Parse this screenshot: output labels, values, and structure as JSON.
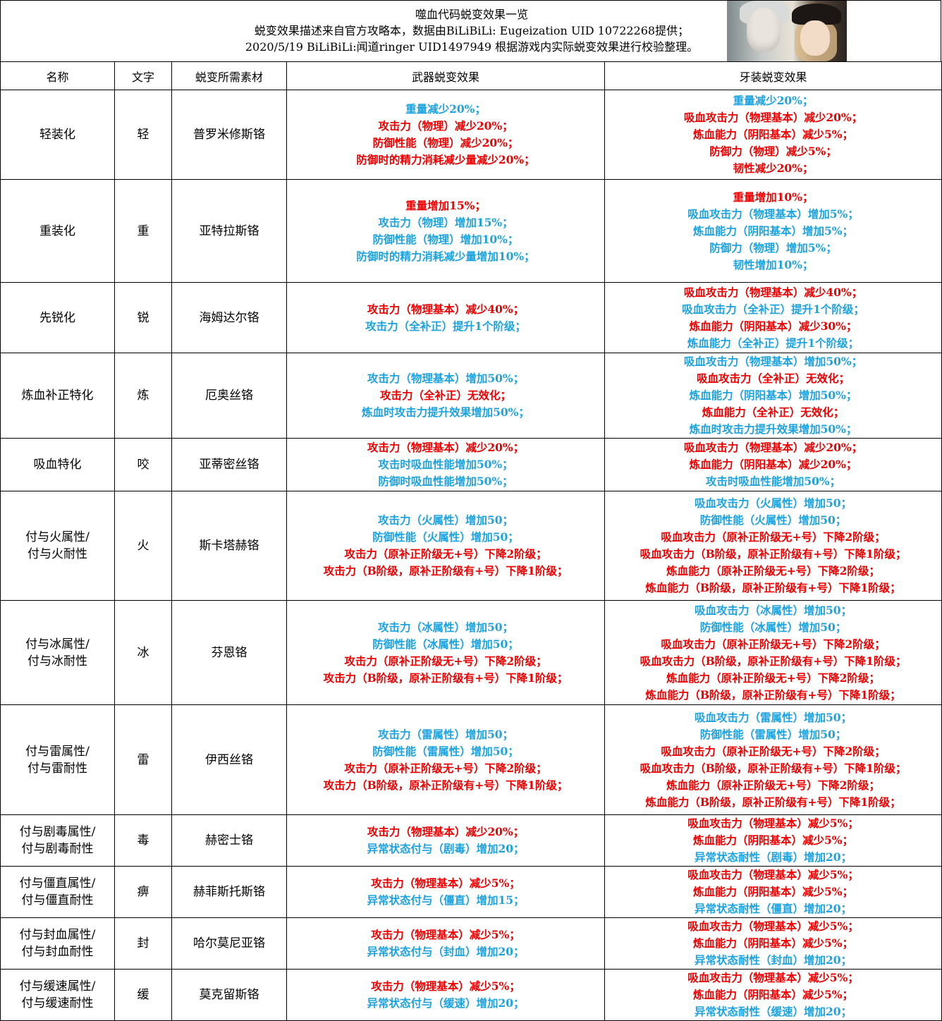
{
  "header": {
    "title": "噬血代码蜕变效果一览",
    "line2": "蜕变效果描述来自官方攻略本，数据由BiLiBiLi: Eugeization UID 10722268提供；",
    "line3": "2020/5/19 BiLiBiLi:闻道ringer UID1497949 根据游戏内实际蜕变效果进行校验整理。"
  },
  "colors": {
    "positive": "#1ba3e0",
    "negative": "#ee0000"
  },
  "columns": [
    "名称",
    "文字",
    "蜕变所需素材",
    "武器蜕变效果",
    "牙装蜕变效果"
  ],
  "rows": [
    {
      "name": [
        "轻装化"
      ],
      "char": "轻",
      "material": "普罗米修斯铬",
      "weapon": [
        {
          "text": "重量减少20%；",
          "c": "blue"
        },
        {
          "text": "攻击力（物理）减少20%；",
          "c": "red"
        },
        {
          "text": "防御性能（物理）减少20%；",
          "c": "red"
        },
        {
          "text": "防御时的精力消耗减少量减少20%；",
          "c": "red"
        }
      ],
      "veil": [
        {
          "text": "重量减少20%；",
          "c": "blue"
        },
        {
          "text": "吸血攻击力（物理基本）减少20%；",
          "c": "red"
        },
        {
          "text": "炼血能力（阴阳基本）减少5%；",
          "c": "red"
        },
        {
          "text": "防御力（物理）减少5%；",
          "c": "red"
        },
        {
          "text": "韧性减少20%；",
          "c": "red"
        }
      ]
    },
    {
      "name": [
        "重装化"
      ],
      "char": "重",
      "material": "亚特拉斯铬",
      "weapon": [
        {
          "text": "重量增加15%；",
          "c": "red"
        },
        {
          "text": "攻击力（物理）增加15%；",
          "c": "blue"
        },
        {
          "text": "防御性能（物理）增加10%；",
          "c": "blue"
        },
        {
          "text": "防御时的精力消耗减少量增加10%；",
          "c": "blue"
        }
      ],
      "veil": [
        {
          "text": "重量增加10%；",
          "c": "red"
        },
        {
          "text": "吸血攻击力（物理基本）增加5%；",
          "c": "blue"
        },
        {
          "text": "炼血能力（阴阳基本）增加5%；",
          "c": "blue"
        },
        {
          "text": "防御力（物理）增加5%；",
          "c": "blue"
        },
        {
          "text": "韧性增加10%；",
          "c": "blue"
        }
      ]
    },
    {
      "name": [
        "先锐化"
      ],
      "char": "锐",
      "material": "海姆达尔铬",
      "weapon": [
        {
          "text": "攻击力（物理基本）减少40%；",
          "c": "red"
        },
        {
          "text": "攻击力（全补正）提升1个阶级；",
          "c": "blue"
        }
      ],
      "veil": [
        {
          "text": "吸血攻击力（物理基本）减少40%；",
          "c": "red"
        },
        {
          "text": "吸血攻击力（全补正）提升1个阶级；",
          "c": "blue"
        },
        {
          "text": "炼血能力（阴阳基本）减少30%；",
          "c": "red"
        },
        {
          "text": "炼血能力（全补正）提升1个阶级；",
          "c": "blue"
        }
      ]
    },
    {
      "name": [
        "炼血补正特化"
      ],
      "char": "炼",
      "material": "厄奥丝铬",
      "weapon": [
        {
          "text": "攻击力（物理基本）增加50%；",
          "c": "blue"
        },
        {
          "text": "攻击力（全补正）无效化；",
          "c": "red"
        },
        {
          "text": "炼血时攻击力提升效果增加50%；",
          "c": "blue"
        }
      ],
      "veil": [
        {
          "text": "吸血攻击力（物理基本）增加50%；",
          "c": "blue"
        },
        {
          "text": "吸血攻击力（全补正）无效化；",
          "c": "red"
        },
        {
          "text": "炼血能力（阴阳基本）增加50%；",
          "c": "blue"
        },
        {
          "text": "炼血能力（全补正）无效化；",
          "c": "red"
        },
        {
          "text": "炼血时攻击力提升效果增加50%；",
          "c": "blue"
        }
      ]
    },
    {
      "name": [
        "吸血特化"
      ],
      "char": "咬",
      "material": "亚蒂密丝铬",
      "weapon": [
        {
          "text": "攻击力（物理基本）减少20%；",
          "c": "red"
        },
        {
          "text": "攻击时吸血性能增加50%；",
          "c": "blue"
        },
        {
          "text": "防御时吸血性能增加50%；",
          "c": "blue"
        }
      ],
      "veil": [
        {
          "text": "吸血攻击力（物理基本）减少20%；",
          "c": "red"
        },
        {
          "text": "炼血能力（阴阳基本）减少20%；",
          "c": "red"
        },
        {
          "text": "攻击时吸血性能增加50%；",
          "c": "blue"
        }
      ]
    },
    {
      "name": [
        "付与火属性/",
        "付与火耐性"
      ],
      "char": "火",
      "material": "斯卡塔赫铬",
      "weapon": [
        {
          "text": "攻击力（火属性）增加50；",
          "c": "blue"
        },
        {
          "text": "防御性能（火属性）增加50；",
          "c": "blue"
        },
        {
          "text": "攻击力（原补正阶级无+号）下降2阶级；",
          "c": "red"
        },
        {
          "text": "攻击力（B阶级，原补正阶级有+号）下降1阶级；",
          "c": "red"
        }
      ],
      "veil": [
        {
          "text": "吸血攻击力（火属性）增加50；",
          "c": "blue"
        },
        {
          "text": "防御性能（火属性）增加50；",
          "c": "blue"
        },
        {
          "text": "吸血攻击力（原补正阶级无+号）下降2阶级；",
          "c": "red"
        },
        {
          "text": "吸血攻击力（B阶级，原补正阶级有+号）下降1阶级；",
          "c": "red"
        },
        {
          "text": "炼血能力（原补正阶级无+号）下降2阶级；",
          "c": "red"
        },
        {
          "text": "炼血能力（B阶级，原补正阶级有+号）下降1阶级；",
          "c": "red"
        }
      ]
    },
    {
      "name": [
        "付与冰属性/",
        "付与冰耐性"
      ],
      "char": "冰",
      "material": "芬恩铬",
      "weapon": [
        {
          "text": "攻击力（冰属性）增加50；",
          "c": "blue"
        },
        {
          "text": "防御性能（冰属性）增加50；",
          "c": "blue"
        },
        {
          "text": "攻击力（原补正阶级无+号）下降2阶级；",
          "c": "red"
        },
        {
          "text": "攻击力（B阶级，原补正阶级有+号）下降1阶级；",
          "c": "red"
        }
      ],
      "veil": [
        {
          "text": "吸血攻击力（冰属性）增加50；",
          "c": "blue"
        },
        {
          "text": "防御性能（冰属性）增加50；",
          "c": "blue"
        },
        {
          "text": "吸血攻击力（原补正阶级无+号）下降2阶级；",
          "c": "red"
        },
        {
          "text": "吸血攻击力（B阶级，原补正阶级有+号）下降1阶级；",
          "c": "red"
        },
        {
          "text": "炼血能力（原补正阶级无+号）下降2阶级；",
          "c": "red"
        },
        {
          "text": "炼血能力（B阶级，原补正阶级有+号）下降1阶级；",
          "c": "red"
        }
      ]
    },
    {
      "name": [
        "付与雷属性/",
        "付与雷耐性"
      ],
      "char": "雷",
      "material": "伊西丝铬",
      "weapon": [
        {
          "text": "攻击力（雷属性）增加50；",
          "c": "blue"
        },
        {
          "text": "防御性能（雷属性）增加50；",
          "c": "blue"
        },
        {
          "text": "攻击力（原补正阶级无+号）下降2阶级；",
          "c": "red"
        },
        {
          "text": "攻击力（B阶级，原补正阶级有+号）下降1阶级；",
          "c": "red"
        }
      ],
      "veil": [
        {
          "text": "吸血攻击力（雷属性）增加50；",
          "c": "blue"
        },
        {
          "text": "防御性能（雷属性）增加50；",
          "c": "blue"
        },
        {
          "text": "吸血攻击力（原补正阶级无+号）下降2阶级；",
          "c": "red"
        },
        {
          "text": "吸血攻击力（B阶级，原补正阶级有+号）下降1阶级；",
          "c": "red"
        },
        {
          "text": "炼血能力（原补正阶级无+号）下降2阶级；",
          "c": "red"
        },
        {
          "text": "炼血能力（B阶级，原补正阶级有+号）下降1阶级；",
          "c": "red"
        }
      ]
    },
    {
      "name": [
        "付与剧毒属性/",
        "付与剧毒耐性"
      ],
      "char": "毒",
      "material": "赫密士铬",
      "weapon": [
        {
          "text": "攻击力（物理基本）减少20%；",
          "c": "red"
        },
        {
          "text": "异常状态付与（剧毒）增加20；",
          "c": "blue"
        }
      ],
      "veil": [
        {
          "text": "吸血攻击力（物理基本）减少5%；",
          "c": "red"
        },
        {
          "text": "炼血能力（阴阳基本）减少5%；",
          "c": "red"
        },
        {
          "text": "异常状态耐性（剧毒）增加20；",
          "c": "blue"
        }
      ]
    },
    {
      "name": [
        "付与僵直属性/",
        "付与僵直耐性"
      ],
      "char": "痹",
      "material": "赫菲斯托斯铬",
      "weapon": [
        {
          "text": "攻击力（物理基本）减少5%；",
          "c": "red"
        },
        {
          "text": "异常状态付与（僵直）增加15；",
          "c": "blue"
        }
      ],
      "veil": [
        {
          "text": "吸血攻击力（物理基本）减少5%；",
          "c": "red"
        },
        {
          "text": "炼血能力（阴阳基本）减少5%；",
          "c": "red"
        },
        {
          "text": "异常状态耐性（僵直）增加20；",
          "c": "blue"
        }
      ]
    },
    {
      "name": [
        "付与封血属性/",
        "付与封血耐性"
      ],
      "char": "封",
      "material": "哈尔莫尼亚铬",
      "weapon": [
        {
          "text": "攻击力（物理基本）减少5%；",
          "c": "red"
        },
        {
          "text": "异常状态付与（封血）增加20；",
          "c": "blue"
        }
      ],
      "veil": [
        {
          "text": "吸血攻击力（物理基本）减少5%；",
          "c": "red"
        },
        {
          "text": "炼血能力（阴阳基本）减少5%；",
          "c": "red"
        },
        {
          "text": "异常状态耐性（封血）增加20；",
          "c": "blue"
        }
      ]
    },
    {
      "name": [
        "付与缓速属性/",
        "付与缓速耐性"
      ],
      "char": "缓",
      "material": "莫克留斯铬",
      "weapon": [
        {
          "text": "攻击力（物理基本）减少5%；",
          "c": "red"
        },
        {
          "text": "异常状态付与（缓速）增加20；",
          "c": "blue"
        }
      ],
      "veil": [
        {
          "text": "吸血攻击力（物理基本）减少5%；",
          "c": "red"
        },
        {
          "text": "炼血能力（阴阳基本）减少5%；",
          "c": "red"
        },
        {
          "text": "异常状态耐性（缓速）增加20；",
          "c": "blue"
        }
      ]
    }
  ]
}
